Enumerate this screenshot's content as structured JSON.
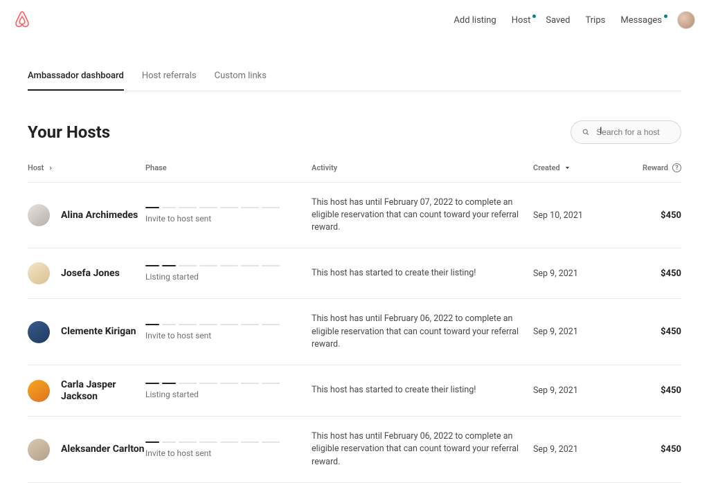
{
  "nav": {
    "add_listing": "Add listing",
    "host": "Host",
    "saved": "Saved",
    "trips": "Trips",
    "messages": "Messages"
  },
  "tabs": {
    "dashboard": "Ambassador dashboard",
    "referrals": "Host referrals",
    "links": "Custom links"
  },
  "title": "Your Hosts",
  "search": {
    "placeholder": "Search for a host"
  },
  "columns": {
    "host": "Host",
    "phase": "Phase",
    "activity": "Activity",
    "created": "Created",
    "reward": "Reward"
  },
  "rows": [
    {
      "name": "Alina Archimedes",
      "phase_label": "Invite to host sent",
      "phase_segments": [
        1,
        0,
        0,
        0,
        0,
        0,
        0
      ],
      "activity": "This host has until February 07, 2022 to complete an eligible reservation that can count toward your referral reward.",
      "created": "Sep 10, 2021",
      "reward": "$450",
      "avatar": "linear-gradient(145deg,#e6e2df,#b8aea6)"
    },
    {
      "name": "Josefa Jones",
      "phase_label": "Listing started",
      "phase_segments": [
        1,
        1,
        0,
        0,
        0,
        0,
        0
      ],
      "activity": "This host has started to create their listing!",
      "created": "Sep 9, 2021",
      "reward": "$450",
      "avatar": "linear-gradient(145deg,#f5e6c8,#d8bf90)"
    },
    {
      "name": "Clemente Kirigan",
      "phase_label": "Invite to host sent",
      "phase_segments": [
        1,
        0,
        0,
        0,
        0,
        0,
        0
      ],
      "activity": "This host has until February 06, 2022 to complete an eligible reservation that can count toward your referral reward.",
      "created": "Sep 9, 2021",
      "reward": "$450",
      "avatar": "linear-gradient(145deg,#3a5a8c,#1e3a5f)"
    },
    {
      "name": "Carla Jasper Jackson",
      "phase_label": "Listing started",
      "phase_segments": [
        1,
        1,
        0,
        0,
        0,
        0,
        0
      ],
      "activity": "This host has started to create their listing!",
      "created": "Sep 9, 2021",
      "reward": "$450",
      "avatar": "linear-gradient(145deg,#f5a623,#e0731c)"
    },
    {
      "name": "Aleksander Carlton",
      "phase_label": "Invite to host sent",
      "phase_segments": [
        1,
        0,
        0,
        0,
        0,
        0,
        0
      ],
      "activity": "This host has until February 06, 2022 to complete an eligible reservation that can count toward your referral reward.",
      "created": "Sep 9, 2021",
      "reward": "$450",
      "avatar": "linear-gradient(145deg,#d9cbb8,#b39e84)"
    }
  ]
}
